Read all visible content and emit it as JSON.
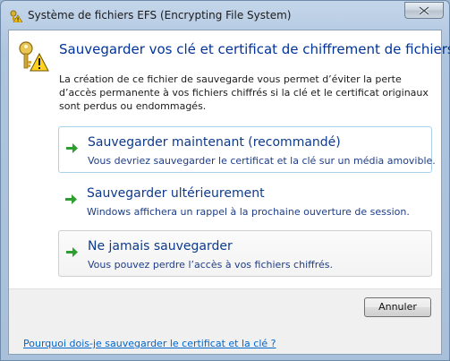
{
  "window": {
    "title": "Système de fichiers EFS (Encrypting File System)",
    "title_icon": "efs-key-warning-icon",
    "close_icon": "close-icon"
  },
  "header": {
    "icon": "key-warning-icon",
    "heading": "Sauvegarder vos clé et certificat de chiffrement de fichiers",
    "description": "La création de ce fichier de sauvegarde vous permet d’éviter la perte d’accès permanente à vos fichiers chiffrés si la clé et le certificat originaux sont perdus ou endommagés."
  },
  "options": [
    {
      "title": "Sauvegarder maintenant (recommandé)",
      "subtitle": "Vous devriez sauvegarder le certificat et la clé sur un média amovible.",
      "icon": "green-arrow-icon"
    },
    {
      "title": "Sauvegarder ultérieurement",
      "subtitle": "Windows affichera un rappel à la prochaine ouverture de session.",
      "icon": "green-arrow-icon"
    },
    {
      "title": "Ne jamais sauvegarder",
      "subtitle": "Vous pouvez perdre l’accès à vos fichiers chiffrés.",
      "icon": "green-arrow-icon"
    }
  ],
  "footer": {
    "cancel_label": "Annuler",
    "help_link": "Pourquoi dois-je sauvegarder le certificat et la clé ?"
  },
  "colors": {
    "heading": "#003399",
    "link": "#0066cc",
    "arrow": "#2e9e2e"
  }
}
